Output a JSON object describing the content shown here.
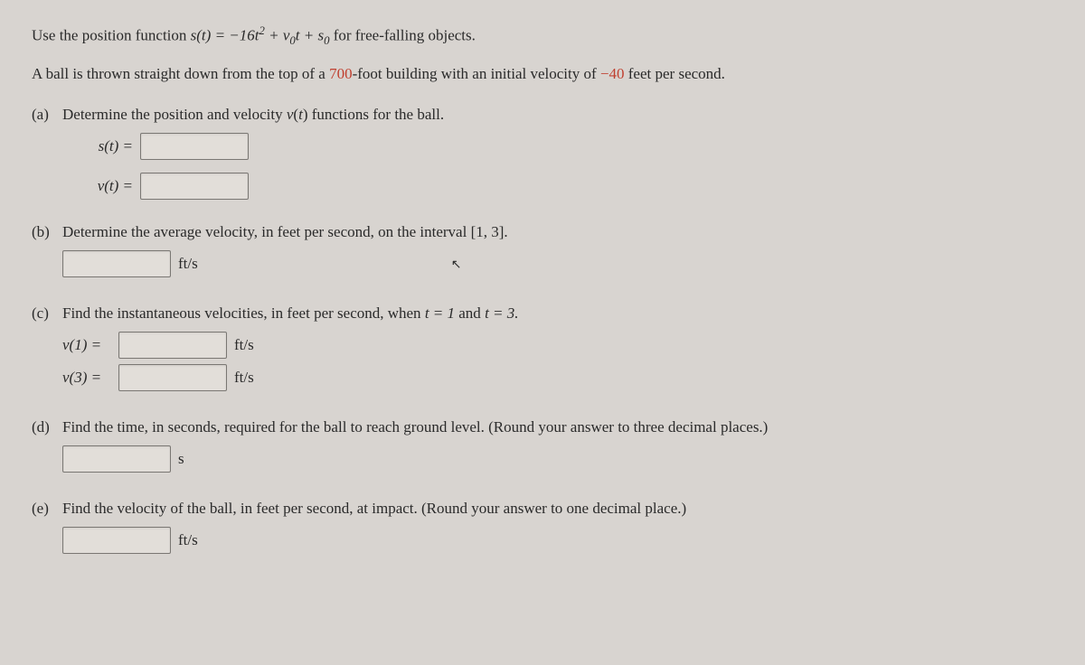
{
  "intro": {
    "prefix": "Use the position function ",
    "eq1_lhs": "s(t) = −16t",
    "eq1_sup": "2",
    "eq1_mid": " + v",
    "eq1_sub1": "0",
    "eq1_mid2": "t + s",
    "eq1_sub2": "0",
    "suffix": " for free-falling objects."
  },
  "setup": {
    "pre": "A ball is thrown straight down from the top of a ",
    "height": "700",
    "mid": "-foot building with an initial velocity of ",
    "velocity": "−40",
    "post": " feet per second."
  },
  "a": {
    "label": "(a)",
    "text": "Determine the position and velocity v(t) functions for the ball.",
    "s_label": "s(t)  =",
    "v_label": "v(t)  ="
  },
  "b": {
    "label": "(b)",
    "text": "Determine the average velocity, in feet per second, on the interval [1, 3].",
    "unit": "ft/s"
  },
  "c": {
    "label": "(c)",
    "pre": "Find the instantaneous velocities, in feet per second, when ",
    "t1": "t = 1",
    "mid": " and ",
    "t2": "t = 3.",
    "v1_label": "v(1)  =",
    "v3_label": "v(3)  =",
    "unit": "ft/s"
  },
  "d": {
    "label": "(d)",
    "text": "Find the time, in seconds, required for the ball to reach ground level. (Round your answer to three decimal places.)",
    "unit": "s"
  },
  "e": {
    "label": "(e)",
    "text": "Find the velocity of the ball, in feet per second, at impact. (Round your answer to one decimal place.)",
    "unit": "ft/s"
  }
}
